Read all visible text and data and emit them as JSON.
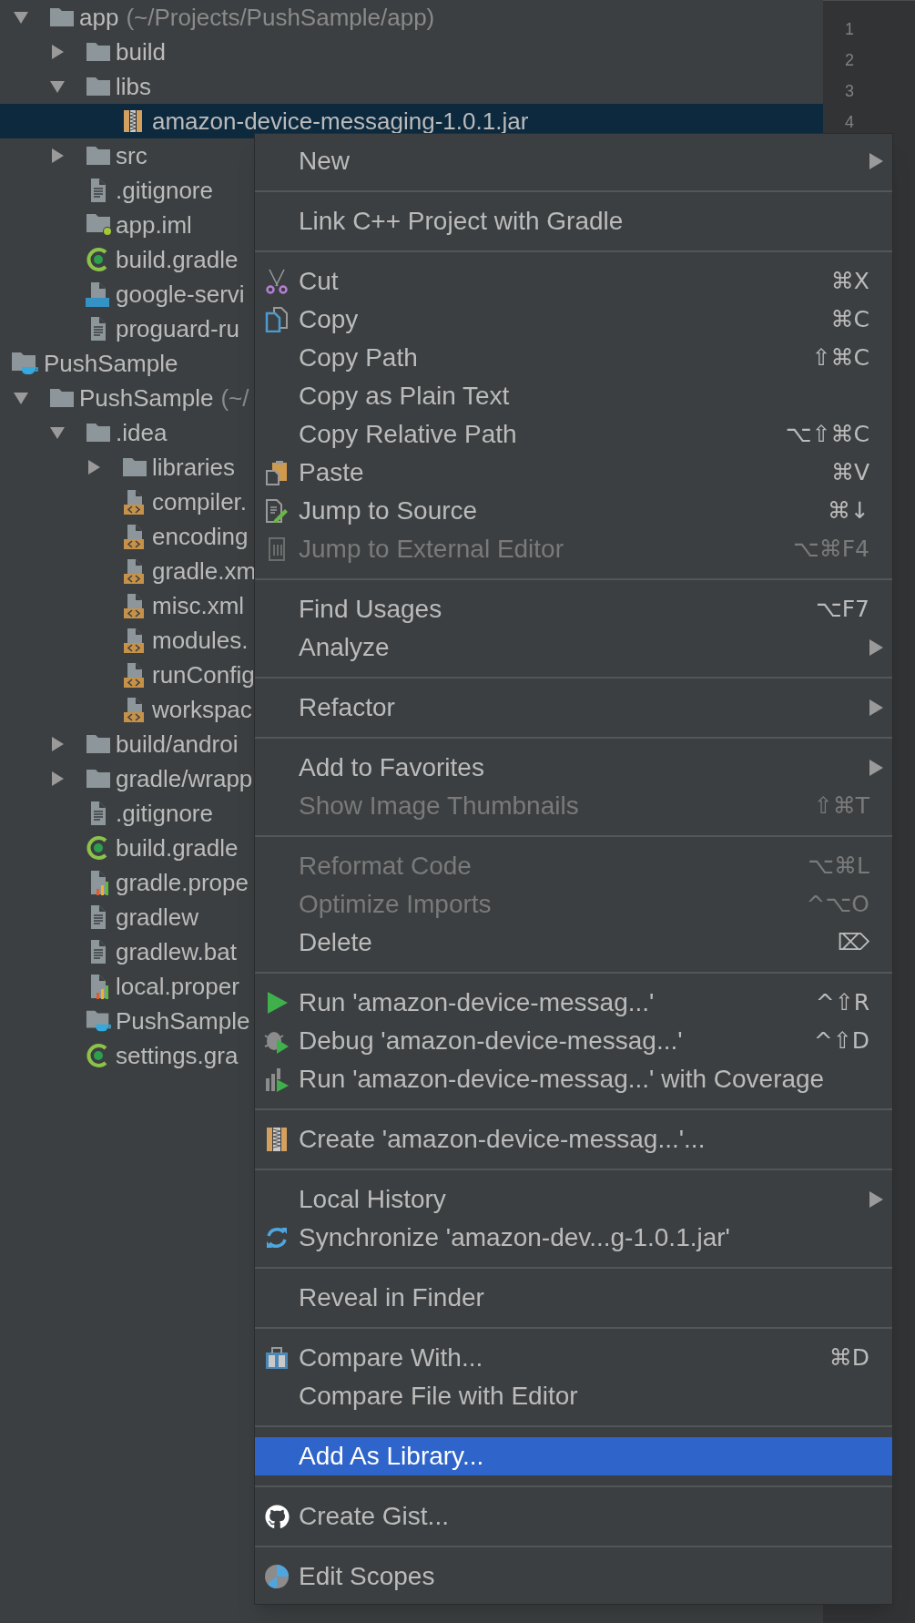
{
  "gutter": {
    "line_numbers": [
      "1",
      "2",
      "3",
      "4"
    ]
  },
  "project_tree": [
    {
      "kind": "folder",
      "name": "app",
      "path": "(~/Projects/PushSample/app)",
      "expanded": true,
      "selected": false,
      "children": [
        {
          "kind": "folder",
          "name": "build",
          "expanded": false,
          "selected": false
        },
        {
          "kind": "folder",
          "name": "libs",
          "expanded": true,
          "selected": false,
          "children": [
            {
              "kind": "jar",
              "name": "amazon-device-messaging-1.0.1.jar",
              "selected": true
            }
          ]
        },
        {
          "kind": "folder",
          "name": "src",
          "expanded": false,
          "selected": false
        },
        {
          "kind": "text",
          "name": ".gitignore",
          "selected": false
        },
        {
          "kind": "module",
          "name": "app.iml",
          "selected": false
        },
        {
          "kind": "gradle",
          "name": "build.gradle",
          "selected": false
        },
        {
          "kind": "json",
          "name": "google-servi",
          "selected": false
        },
        {
          "kind": "text",
          "name": "proguard-ru",
          "selected": false
        }
      ]
    },
    {
      "kind": "project",
      "name": "PushSample",
      "selected": false
    },
    {
      "kind": "folder",
      "name": "PushSample",
      "path": "(~/",
      "expanded": true,
      "selected": false,
      "children": [
        {
          "kind": "folder",
          "name": ".idea",
          "expanded": true,
          "selected": false,
          "children": [
            {
              "kind": "folder",
              "name": "libraries",
              "expanded": false,
              "selected": false
            },
            {
              "kind": "xml",
              "name": "compiler.",
              "selected": false
            },
            {
              "kind": "xml",
              "name": "encoding",
              "selected": false
            },
            {
              "kind": "xml",
              "name": "gradle.xm",
              "selected": false
            },
            {
              "kind": "xml",
              "name": "misc.xml",
              "selected": false
            },
            {
              "kind": "xml",
              "name": "modules.",
              "selected": false
            },
            {
              "kind": "xml",
              "name": "runConfig",
              "selected": false
            },
            {
              "kind": "xml",
              "name": "workspac",
              "selected": false
            }
          ]
        },
        {
          "kind": "folder",
          "name": "build/androi",
          "expanded": false,
          "selected": false
        },
        {
          "kind": "folder",
          "name": "gradle/wrapp",
          "expanded": false,
          "selected": false
        },
        {
          "kind": "text",
          "name": ".gitignore",
          "selected": false
        },
        {
          "kind": "gradle",
          "name": "build.gradle",
          "selected": false
        },
        {
          "kind": "properties",
          "name": "gradle.prope",
          "selected": false
        },
        {
          "kind": "text",
          "name": "gradlew",
          "selected": false
        },
        {
          "kind": "text",
          "name": "gradlew.bat",
          "selected": false
        },
        {
          "kind": "properties",
          "name": "local.proper",
          "selected": false
        },
        {
          "kind": "iml",
          "name": "PushSample",
          "selected": false
        },
        {
          "kind": "gradle",
          "name": "settings.gra",
          "selected": false
        }
      ]
    }
  ],
  "context_menu": {
    "groups": [
      [
        {
          "kind": "plain",
          "label": "New",
          "submenu": true,
          "disabled": false,
          "selected": false
        }
      ],
      [
        {
          "kind": "plain",
          "label": "Link C++ Project with Gradle",
          "submenu": false,
          "disabled": false,
          "selected": false
        }
      ],
      [
        {
          "kind": "cut",
          "label": "Cut",
          "shortcut": "⌘X",
          "submenu": false,
          "disabled": false,
          "selected": false
        },
        {
          "kind": "copy",
          "label": "Copy",
          "shortcut": "⌘C",
          "submenu": false,
          "disabled": false,
          "selected": false
        },
        {
          "kind": "plain",
          "label": "Copy Path",
          "shortcut": "⇧⌘C",
          "submenu": false,
          "disabled": false,
          "selected": false
        },
        {
          "kind": "plain",
          "label": "Copy as Plain Text",
          "submenu": false,
          "disabled": false,
          "selected": false
        },
        {
          "kind": "plain",
          "label": "Copy Relative Path",
          "shortcut": "⌥⇧⌘C",
          "submenu": false,
          "disabled": false,
          "selected": false
        },
        {
          "kind": "paste",
          "label": "Paste",
          "shortcut": "⌘V",
          "submenu": false,
          "disabled": false,
          "selected": false
        },
        {
          "kind": "source",
          "label": "Jump to Source",
          "shortcut": "⌘↓",
          "submenu": false,
          "disabled": false,
          "selected": false
        },
        {
          "kind": "external",
          "label": "Jump to External Editor",
          "shortcut": "⌥⌘F4",
          "submenu": false,
          "disabled": true,
          "selected": false
        }
      ],
      [
        {
          "kind": "plain",
          "label": "Find Usages",
          "shortcut": "⌥F7",
          "submenu": false,
          "disabled": false,
          "selected": false
        },
        {
          "kind": "plain",
          "label": "Analyze",
          "submenu": true,
          "disabled": false,
          "selected": false
        }
      ],
      [
        {
          "kind": "plain",
          "label": "Refactor",
          "submenu": true,
          "disabled": false,
          "selected": false
        }
      ],
      [
        {
          "kind": "plain",
          "label": "Add to Favorites",
          "submenu": true,
          "disabled": false,
          "selected": false
        },
        {
          "kind": "plain",
          "label": "Show Image Thumbnails",
          "shortcut": "⇧⌘T",
          "submenu": false,
          "disabled": true,
          "selected": false
        }
      ],
      [
        {
          "kind": "plain",
          "label": "Reformat Code",
          "shortcut": "⌥⌘L",
          "submenu": false,
          "disabled": true,
          "selected": false
        },
        {
          "kind": "plain",
          "label": "Optimize Imports",
          "shortcut": "^⌥O",
          "submenu": false,
          "disabled": true,
          "selected": false
        },
        {
          "kind": "plain",
          "label": "Delete",
          "shortcut": "⌦",
          "submenu": false,
          "disabled": false,
          "selected": false
        }
      ],
      [
        {
          "kind": "run",
          "label": "Run 'amazon-device-messag...'",
          "shortcut": "^⇧R",
          "submenu": false,
          "disabled": false,
          "selected": false
        },
        {
          "kind": "debug",
          "label": "Debug 'amazon-device-messag...'",
          "shortcut": "^⇧D",
          "submenu": false,
          "disabled": false,
          "selected": false
        },
        {
          "kind": "coverage",
          "label": "Run 'amazon-device-messag...' with Coverage",
          "submenu": false,
          "disabled": false,
          "selected": false
        }
      ],
      [
        {
          "kind": "archive",
          "label": "Create 'amazon-device-messag...'...",
          "submenu": false,
          "disabled": false,
          "selected": false
        }
      ],
      [
        {
          "kind": "plain",
          "label": "Local History",
          "submenu": true,
          "disabled": false,
          "selected": false
        },
        {
          "kind": "sync",
          "label": "Synchronize 'amazon-dev...g-1.0.1.jar'",
          "submenu": false,
          "disabled": false,
          "selected": false
        }
      ],
      [
        {
          "kind": "plain",
          "label": "Reveal in Finder",
          "submenu": false,
          "disabled": false,
          "selected": false
        }
      ],
      [
        {
          "kind": "compare",
          "label": "Compare With...",
          "shortcut": "⌘D",
          "submenu": false,
          "disabled": false,
          "selected": false
        },
        {
          "kind": "plain",
          "label": "Compare File with Editor",
          "submenu": false,
          "disabled": false,
          "selected": false
        }
      ],
      [
        {
          "kind": "plain",
          "label": "Add As Library...",
          "submenu": false,
          "disabled": false,
          "selected": true
        }
      ],
      [
        {
          "kind": "gist",
          "label": "Create Gist...",
          "submenu": false,
          "disabled": false,
          "selected": false
        }
      ],
      [
        {
          "kind": "scopes",
          "label": "Edit Scopes",
          "submenu": false,
          "disabled": false,
          "selected": false
        }
      ]
    ]
  }
}
